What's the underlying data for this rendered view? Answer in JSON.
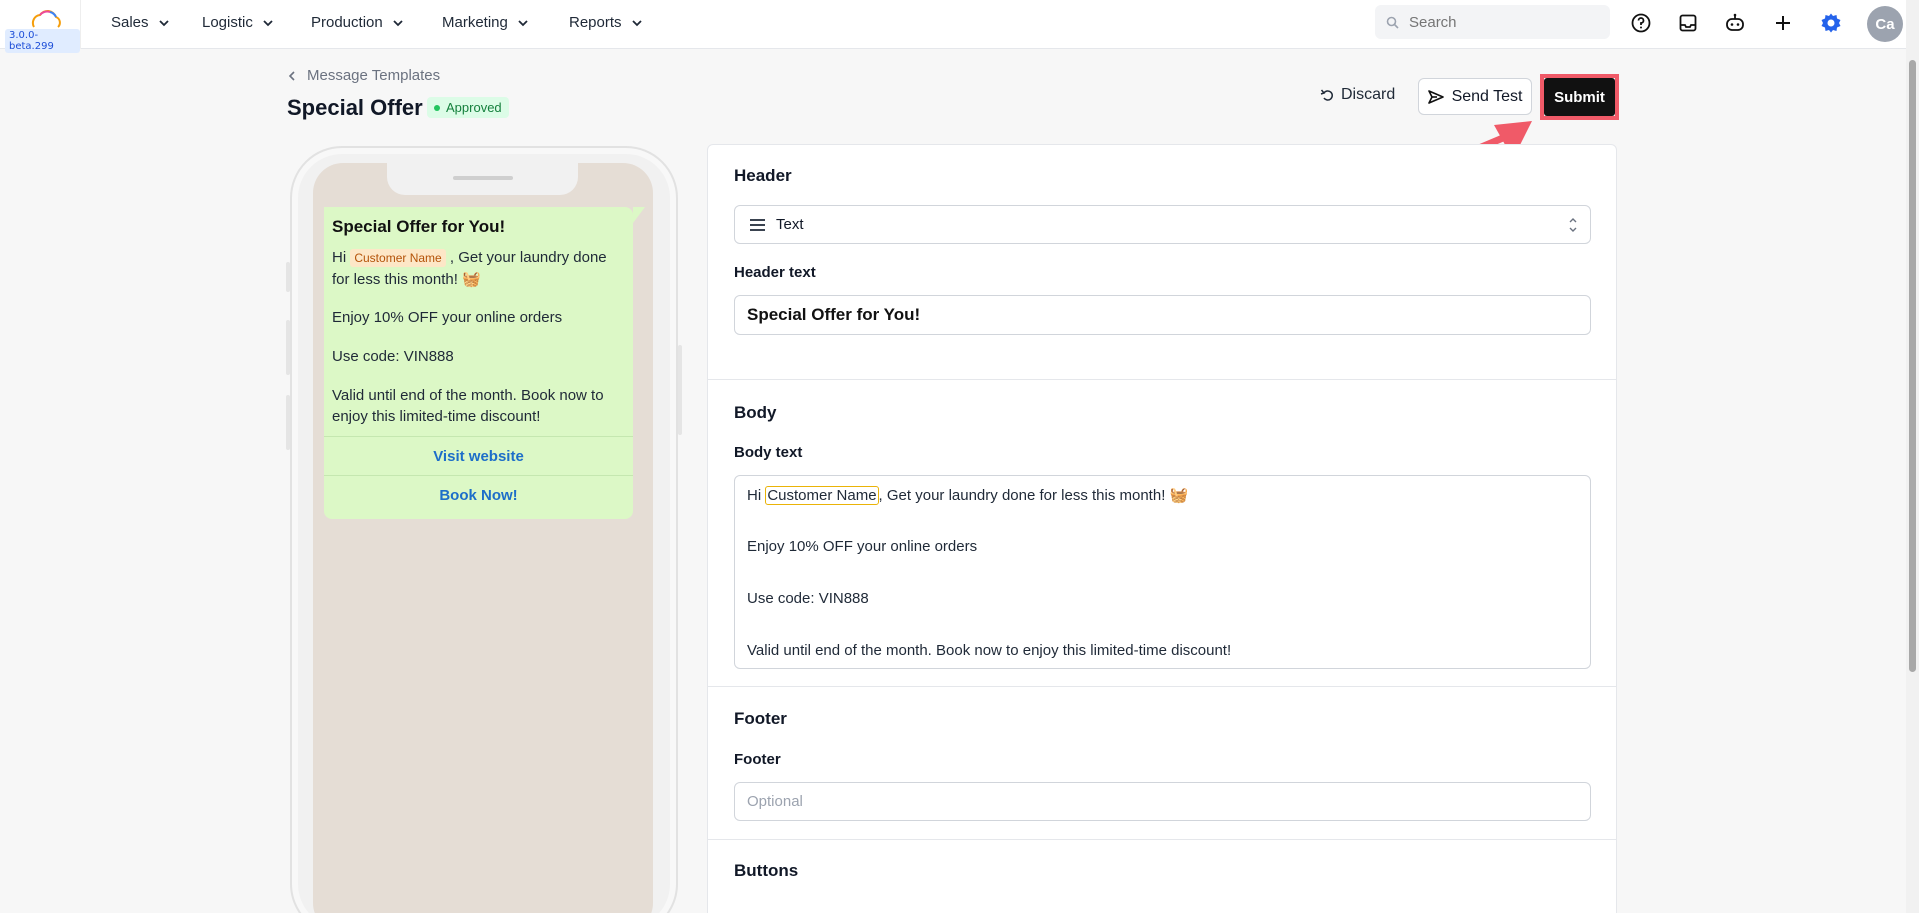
{
  "app": {
    "version": "3.0.0-beta.299",
    "avatar_initials": "Ca"
  },
  "nav": {
    "items": [
      {
        "label": "Sales"
      },
      {
        "label": "Logistic"
      },
      {
        "label": "Production"
      },
      {
        "label": "Marketing"
      },
      {
        "label": "Reports"
      }
    ],
    "search_placeholder": "Search"
  },
  "page": {
    "breadcrumb": "Message Templates",
    "title": "Special Offer",
    "status": "Approved",
    "actions": {
      "discard": "Discard",
      "send_test": "Send Test",
      "submit": "Submit"
    }
  },
  "preview": {
    "header": "Special Offer for You!",
    "line1_prefix": "Hi ",
    "variable": "Customer Name",
    "line1_suffix": " , Get your laundry done for less this month! 🧺",
    "line2": "Enjoy 10% OFF your online orders",
    "line3": "Use code: VIN888",
    "line4": "Valid until end of the month. Book now to enjoy this limited-time discount!",
    "buttons": [
      "Visit website",
      "Book Now!"
    ]
  },
  "form": {
    "header_section": "Header",
    "header_type": "Text",
    "header_text_label": "Header text",
    "header_text_value": "Special Offer for You!",
    "body_section": "Body",
    "body_text_label": "Body text",
    "body_prefix": "Hi ",
    "body_variable": "Customer Name",
    "body_suffix": ", Get your laundry done for less this month! 🧺",
    "body_line2": "Enjoy 10% OFF your online orders",
    "body_line3": "Use code: VIN888",
    "body_line4": "Valid until end of the month. Book now to enjoy this limited-time discount!",
    "footer_section": "Footer",
    "footer_label": "Footer",
    "footer_placeholder": "Optional",
    "buttons_section": "Buttons"
  },
  "colors": {
    "accent": "#2563eb",
    "highlight": "#f05a68",
    "bubble": "#dcf8c6",
    "chat_bg": "#e5ddd5"
  }
}
